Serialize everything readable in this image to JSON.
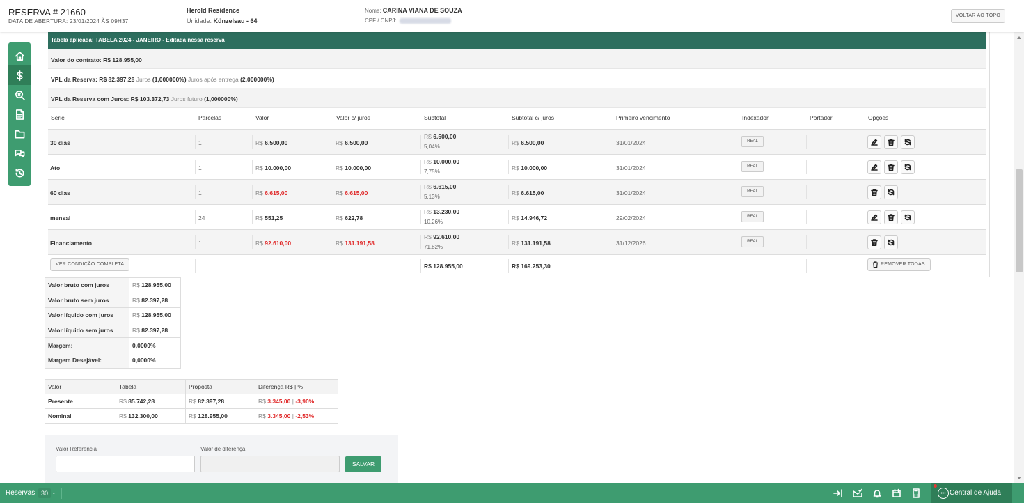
{
  "topbar": {
    "reserva": "RESERVA # 21660",
    "abertura": "DATA DE ABERTURA: 23/01/2024 ÀS 09H37",
    "empreendimento": "Herold Residence",
    "unidade_label": "Unidade:",
    "unidade_value": "Künzelsau - 64",
    "nome_label": "Nome:",
    "nome_value": "CARINA VIANA DE SOUZA",
    "cpf_label": "CPF / CNPJ:",
    "voltar_topo": "VOLTAR AO TOPO"
  },
  "sidebar": {
    "items": [
      {
        "icon": "home-icon"
      },
      {
        "icon": "dollar-icon"
      },
      {
        "icon": "search-money-icon"
      },
      {
        "icon": "document-icon"
      },
      {
        "icon": "folder-icon"
      },
      {
        "icon": "chat-icon"
      },
      {
        "icon": "history-icon"
      }
    ]
  },
  "main": {
    "tabela_aplicada": "Tabela aplicada: TABELA 2024 - JANEIRO - Editada nessa reserva",
    "valor_contrato": "Valor do contrato: R$ 128.955,00",
    "vpl_reserva": "VPL da Reserva: R$ 82.397,28",
    "juros_label": "Juros",
    "juros_value": "(1,000000%)",
    "juros_apos_label": "Juros após entrega",
    "juros_apos_value": "(2,000000%)",
    "vpl_juros": "VPL da Reserva com Juros: R$ 103.372,73",
    "juros_futuro_label": "Juros futuro",
    "juros_futuro_value": "(1,000000%)"
  },
  "table": {
    "headers": [
      "Série",
      "Parcelas",
      "Valor",
      "Valor c/ juros",
      "Subtotal",
      "Subtotal c/ juros",
      "Primeiro vencimento",
      "Indexador",
      "Portador",
      "Opções"
    ],
    "currency": "R$",
    "rows": [
      {
        "serie": "30 dias",
        "parcelas": "1",
        "valor": "6.500,00",
        "valor_juros": "6.500,00",
        "subtotal": "6.500,00",
        "subtotal_pct": "5,04%",
        "subtotal_juros": "6.500,00",
        "vencimento": "31/01/2024",
        "indexador": "REAL"
      },
      {
        "serie": "Ato",
        "parcelas": "1",
        "valor": "10.000,00",
        "valor_juros": "10.000,00",
        "subtotal": "10.000,00",
        "subtotal_pct": "7,75%",
        "subtotal_juros": "10.000,00",
        "vencimento": "31/01/2024",
        "indexador": "REAL"
      },
      {
        "serie": "60 dias",
        "parcelas": "1",
        "valor": "6.615,00",
        "valor_juros": "6.615,00",
        "subtotal": "6.615,00",
        "subtotal_pct": "5,13%",
        "subtotal_juros": "6.615,00",
        "vencimento": "31/01/2024",
        "indexador": "REAL"
      },
      {
        "serie": "mensal",
        "parcelas": "24",
        "valor": "551,25",
        "valor_juros": "622,78",
        "subtotal": "13.230,00",
        "subtotal_pct": "10,26%",
        "subtotal_juros": "14.946,72",
        "vencimento": "29/02/2024",
        "indexador": "REAL"
      },
      {
        "serie": "Financiamento",
        "parcelas": "1",
        "valor": "92.610,00",
        "valor_juros": "131.191,58",
        "subtotal": "92.610,00",
        "subtotal_pct": "71,82%",
        "subtotal_juros": "131.191,58",
        "vencimento": "31/12/2026",
        "indexador": "REAL"
      }
    ],
    "footer": {
      "ver_condicao": "VER CONDIÇÃO COMPLETA",
      "total_subtotal": "R$ 128.955,00",
      "total_subtotal_juros": "R$ 169.253,30",
      "remover_todas": "REMOVER TODAS"
    }
  },
  "summary": [
    {
      "label": "Valor bruto com juros",
      "value": "128.955,00"
    },
    {
      "label": "Valor bruto sem juros",
      "value": "82.397,28"
    },
    {
      "label": "Valor líquido com juros",
      "value": "128.955,00"
    },
    {
      "label": "Valor líquido sem juros",
      "value": "82.397,28"
    },
    {
      "label": "Margem:",
      "value": "0,0000%"
    },
    {
      "label": "Margem Desejável:",
      "value": "0,0000%"
    }
  ],
  "compare": {
    "headers": [
      "Valor",
      "Tabela",
      "Proposta",
      "Diferença R$ | %"
    ],
    "rows": [
      {
        "label": "Presente",
        "tabela": "85.742,28",
        "proposta": "82.397,28",
        "dif": "3.345,00",
        "pct": "-3,90%"
      },
      {
        "label": "Nominal",
        "tabela": "132.300,00",
        "proposta": "128.955,00",
        "dif": "3.345,00",
        "pct": "-2,53%"
      }
    ]
  },
  "referencia": {
    "valor_referencia_label": "Valor Referência",
    "valor_diferenca_label": "Valor de diferença",
    "salvar": "SALVAR"
  },
  "bottombar": {
    "reservas_label": "Reservas",
    "reservas_count": "30",
    "central_ajuda": "Central de Ajuda"
  }
}
